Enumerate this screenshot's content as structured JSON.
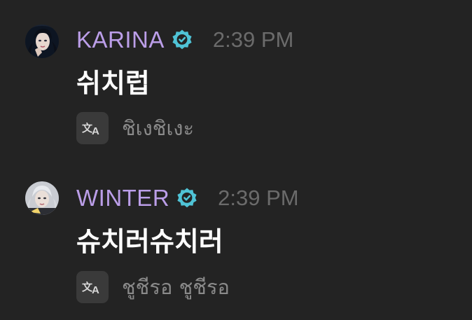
{
  "messages": [
    {
      "avatar_icon": "profile-photo",
      "author": "KARINA",
      "verified_icon": "verified-badge-icon",
      "time": "2:39 PM",
      "text": "쉬치럽",
      "translate_icon": "translate-icon",
      "translation": "ชิเงชิเงะ"
    },
    {
      "avatar_icon": "profile-photo",
      "author": "WINTER",
      "verified_icon": "verified-badge-icon",
      "time": "2:39 PM",
      "text": "슈치러슈치러",
      "translate_icon": "translate-icon",
      "translation": "ชูชีรอ ชูชีรอ"
    }
  ],
  "colors": {
    "background": "#232323",
    "author": "#bb9ee8",
    "verified": "#4fc3d6",
    "timestamp": "#6b6b6b",
    "message": "#ffffff",
    "translation": "#8a8a8a",
    "translate_button": "#3a3a3a"
  }
}
